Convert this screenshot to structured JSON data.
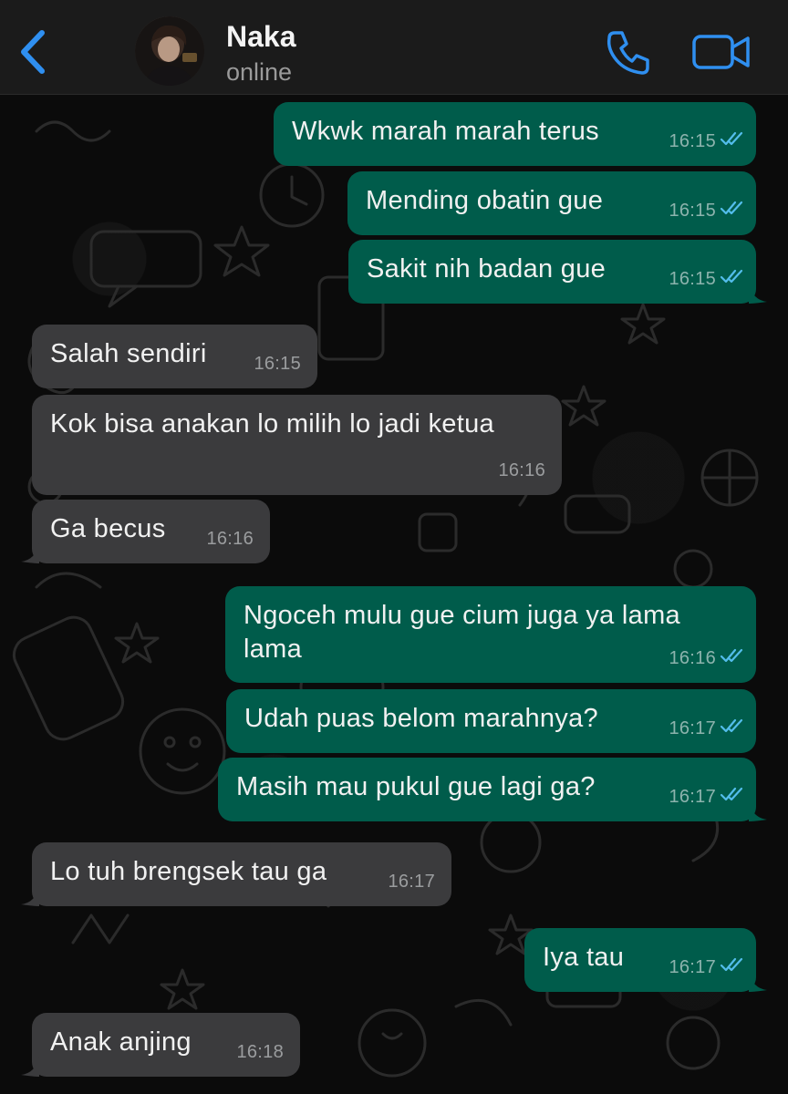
{
  "header": {
    "contact_name": "Naka",
    "status": "online",
    "accent_color": "#2f8ff0"
  },
  "messages": [
    {
      "dir": "out",
      "text": "Wkwk marah marah terus",
      "time": "16:15",
      "read": true
    },
    {
      "dir": "out",
      "text": "Mending obatin gue",
      "time": "16:15",
      "read": true
    },
    {
      "dir": "out",
      "text": "Sakit nih badan gue",
      "time": "16:15",
      "read": true
    },
    {
      "dir": "in",
      "text": "Salah sendiri",
      "time": "16:15"
    },
    {
      "dir": "in",
      "text": "Kok bisa anakan lo milih lo jadi ketua",
      "time": "16:16"
    },
    {
      "dir": "in",
      "text": "Ga becus",
      "time": "16:16"
    },
    {
      "dir": "out",
      "text": "Ngoceh mulu gue cium juga ya lama lama",
      "time": "16:16",
      "read": true
    },
    {
      "dir": "out",
      "text": "Udah puas belom marahnya?",
      "time": "16:17",
      "read": true
    },
    {
      "dir": "out",
      "text": "Masih mau pukul gue lagi ga?",
      "time": "16:17",
      "read": true
    },
    {
      "dir": "in",
      "text": "Lo tuh brengsek tau ga",
      "time": "16:17"
    },
    {
      "dir": "out",
      "text": "Iya tau",
      "time": "16:17",
      "read": true
    },
    {
      "dir": "in",
      "text": "Anak anjing",
      "time": "16:18"
    }
  ],
  "colors": {
    "outgoing_bubble": "#005c4b",
    "incoming_bubble": "#3b3b3d",
    "read_tick": "#53bdeb",
    "background": "#0b0b0b"
  }
}
